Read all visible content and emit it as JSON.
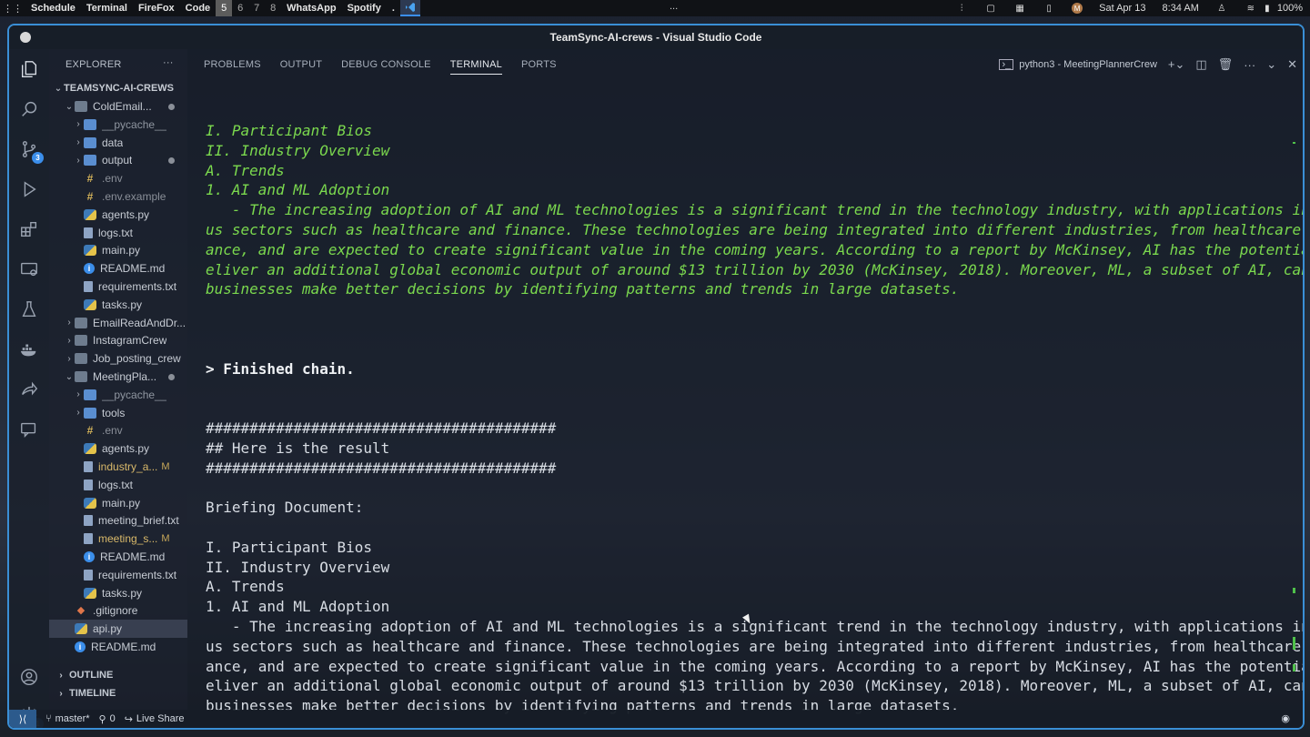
{
  "sysbar": {
    "apps": [
      "Schedule",
      "Terminal",
      "FireFox",
      "Code"
    ],
    "workspaces": [
      "5",
      "6",
      "7",
      "8"
    ],
    "active_workspace": "5",
    "apps2": [
      "WhatsApp",
      "Spotify",
      "."
    ],
    "center": "...",
    "date": "Sat Apr 13",
    "time": "8:34 AM",
    "battery": "100%",
    "avatar_letter": "M"
  },
  "window": {
    "title": "TeamSync-AI-crews - Visual Studio Code"
  },
  "activity": {
    "scm_badge": "3",
    "settings_badge": "1"
  },
  "sidebar": {
    "title": "EXPLORER",
    "more": "···",
    "root": "TEAMSYNC-AI-CREWS",
    "items": [
      {
        "label": "ColdEmail...",
        "kind": "folder-open"
      },
      {
        "label": "__pycache__",
        "kind": "folder"
      },
      {
        "label": "data",
        "kind": "folder"
      },
      {
        "label": "output",
        "kind": "folder"
      },
      {
        "label": ".env",
        "kind": "env"
      },
      {
        "label": ".env.example",
        "kind": "env"
      },
      {
        "label": "agents.py",
        "kind": "py"
      },
      {
        "label": "logs.txt",
        "kind": "txt"
      },
      {
        "label": "main.py",
        "kind": "py"
      },
      {
        "label": "README.md",
        "kind": "info"
      },
      {
        "label": "requirements.txt",
        "kind": "txt"
      },
      {
        "label": "tasks.py",
        "kind": "py"
      },
      {
        "label": "EmailReadAndDr...",
        "kind": "folder"
      },
      {
        "label": "InstagramCrew",
        "kind": "folder"
      },
      {
        "label": "Job_posting_crew",
        "kind": "folder"
      },
      {
        "label": "MeetingPla...",
        "kind": "folder-open"
      },
      {
        "label": "__pycache__",
        "kind": "folder"
      },
      {
        "label": "tools",
        "kind": "folder"
      },
      {
        "label": ".env",
        "kind": "env"
      },
      {
        "label": "agents.py",
        "kind": "py"
      },
      {
        "label": "industry_a...",
        "kind": "txt",
        "mod": "M"
      },
      {
        "label": "logs.txt",
        "kind": "txt"
      },
      {
        "label": "main.py",
        "kind": "py"
      },
      {
        "label": "meeting_brief.txt",
        "kind": "txt"
      },
      {
        "label": "meeting_s...",
        "kind": "txt",
        "mod": "M"
      },
      {
        "label": "README.md",
        "kind": "info"
      },
      {
        "label": "requirements.txt",
        "kind": "txt"
      },
      {
        "label": "tasks.py",
        "kind": "py"
      },
      {
        "label": ".gitignore",
        "kind": "git"
      },
      {
        "label": "api.py",
        "kind": "py"
      },
      {
        "label": "README.md",
        "kind": "info"
      }
    ],
    "outline": "OUTLINE",
    "timeline": "TIMELINE"
  },
  "panel": {
    "tabs": [
      "PROBLEMS",
      "OUTPUT",
      "DEBUG CONSOLE",
      "TERMINAL",
      "PORTS"
    ],
    "active_tab": "TERMINAL",
    "terminal_name": "python3 - MeetingPlannerCrew"
  },
  "terminal": {
    "lines": [
      {
        "t": "I. Participant Bios",
        "s": "green"
      },
      {
        "t": "II. Industry Overview",
        "s": "green"
      },
      {
        "t": "A. Trends",
        "s": "green"
      },
      {
        "t": "1. AI and ML Adoption",
        "s": "green"
      },
      {
        "t": "   - The increasing adoption of AI and ML technologies is a significant trend in the technology industry, with applications in vario",
        "s": "green"
      },
      {
        "t": "us sectors such as healthcare and finance. These technologies are being integrated into different industries, from healthcare to fin",
        "s": "green"
      },
      {
        "t": "ance, and are expected to create significant value in the coming years. According to a report by McKinsey, AI has the potential to d",
        "s": "green"
      },
      {
        "t": "eliver an additional global economic output of around $13 trillion by 2030 (McKinsey, 2018). Moreover, ML, a subset of AI, can help",
        "s": "green"
      },
      {
        "t": "businesses make better decisions by identifying patterns and trends in large datasets.",
        "s": "green"
      },
      {
        "t": "",
        "s": ""
      },
      {
        "t": "",
        "s": ""
      },
      {
        "t": "",
        "s": ""
      },
      {
        "t": "> Finished chain.",
        "s": "bold"
      },
      {
        "t": "",
        "s": ""
      },
      {
        "t": "",
        "s": ""
      },
      {
        "t": "########################################",
        "s": ""
      },
      {
        "t": "## Here is the result",
        "s": ""
      },
      {
        "t": "########################################",
        "s": ""
      },
      {
        "t": "",
        "s": ""
      },
      {
        "t": "Briefing Document:",
        "s": ""
      },
      {
        "t": "",
        "s": ""
      },
      {
        "t": "I. Participant Bios",
        "s": ""
      },
      {
        "t": "II. Industry Overview",
        "s": ""
      },
      {
        "t": "A. Trends",
        "s": ""
      },
      {
        "t": "1. AI and ML Adoption",
        "s": ""
      },
      {
        "t": "   - The increasing adoption of AI and ML technologies is a significant trend in the technology industry, with applications in vario",
        "s": ""
      },
      {
        "t": "us sectors such as healthcare and finance. These technologies are being integrated into different industries, from healthcare to fin",
        "s": ""
      },
      {
        "t": "ance, and are expected to create significant value in the coming years. According to a report by McKinsey, AI has the potential to d",
        "s": ""
      },
      {
        "t": "eliver an additional global economic output of around $13 trillion by 2030 (McKinsey, 2018). Moreover, ML, a subset of AI, can help",
        "s": ""
      },
      {
        "t": "businesses make better decisions by identifying patterns and trends in large datasets.",
        "s": ""
      }
    ]
  },
  "status": {
    "branch": "master*",
    "ports": "0",
    "live_share": "Live Share"
  }
}
